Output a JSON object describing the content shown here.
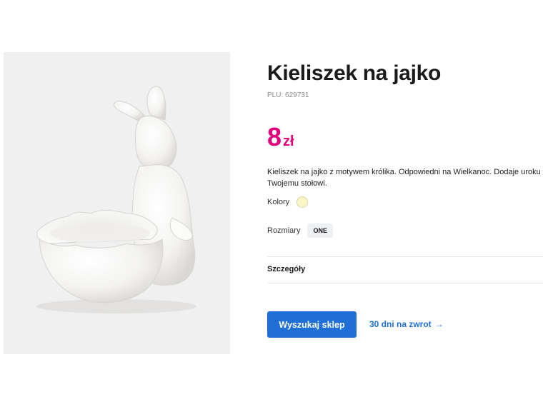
{
  "product": {
    "title": "Kieliszek na jajko",
    "plu": "PLU: 629731",
    "price_amount": "8",
    "price_currency": "zł",
    "description": "Kieliszek na jajko z motywem królika. Odpowiedni na Wielkanoc. Dodaje uroku Twojemu stołowi.",
    "image_alt": "ceramic-bunny-egg-cup"
  },
  "options": {
    "colors_label": "Kolory",
    "color_swatch": "#fbf6c6",
    "sizes_label": "Rozmiary",
    "size_value": "ONE"
  },
  "details_label": "Szczegóły",
  "actions": {
    "find_store_label": "Wyszukaj sklep",
    "returns_label": "30 dni na zwrot",
    "returns_icon": "arrow-right-icon"
  },
  "colors": {
    "price": "#e2007a",
    "primary_blue": "#1f6fd6",
    "photo_bg": "#f0f0f0"
  }
}
